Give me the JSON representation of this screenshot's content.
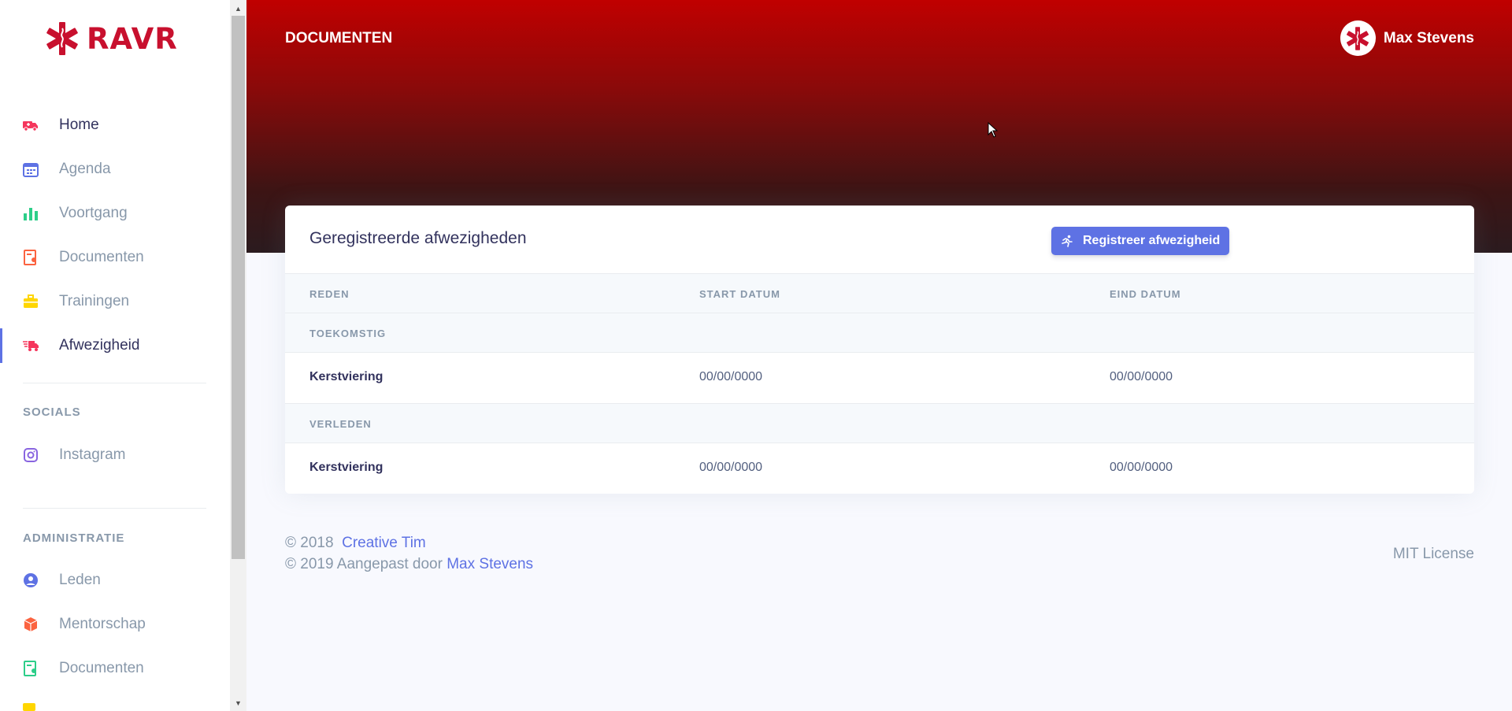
{
  "brand": {
    "name": "RAVR",
    "accent": "#c8102e"
  },
  "sidebar": {
    "items": [
      {
        "label": "Home",
        "icon": "ambulance-icon",
        "color": "#f5365c"
      },
      {
        "label": "Agenda",
        "icon": "calendar-icon",
        "color": "#5e72e4"
      },
      {
        "label": "Voortgang",
        "icon": "bar-chart-icon",
        "color": "#2dce89"
      },
      {
        "label": "Documenten",
        "icon": "document-icon",
        "color": "#fb6340"
      },
      {
        "label": "Trainingen",
        "icon": "briefcase-icon",
        "color": "#ffd600"
      },
      {
        "label": "Afwezigheid",
        "icon": "truck-icon",
        "color": "#f5365c"
      }
    ],
    "socials_heading": "SOCIALS",
    "socials": [
      {
        "label": "Instagram",
        "icon": "instagram-icon",
        "color": "#8965e0"
      }
    ],
    "admin_heading": "ADMINISTRATIE",
    "admin": [
      {
        "label": "Leden",
        "icon": "user-circle-icon",
        "color": "#5e72e4"
      },
      {
        "label": "Mentorschap",
        "icon": "box-icon",
        "color": "#fb6340"
      },
      {
        "label": "Documenten",
        "icon": "document-icon",
        "color": "#2dce89"
      }
    ]
  },
  "header": {
    "page_title": "DOCUMENTEN",
    "user_name": "Max Stevens"
  },
  "card": {
    "title": "Geregistreerde afwezigheden",
    "button_label": "Registreer afwezigheid",
    "columns": [
      "REDEN",
      "START DATUM",
      "EIND DATUM"
    ],
    "groups": [
      {
        "label": "TOEKOMSTIG",
        "rows": [
          {
            "reason": "Kerstviering",
            "start": "00/00/0000",
            "end": "00/00/0000"
          }
        ]
      },
      {
        "label": "VERLEDEN",
        "rows": [
          {
            "reason": "Kerstviering",
            "start": "00/00/0000",
            "end": "00/00/0000"
          }
        ]
      }
    ]
  },
  "footer": {
    "line1_prefix": "© 2018",
    "line1_link": "Creative Tim",
    "line2_prefix": "© 2019 Aangepast door",
    "line2_link": "Max Stevens",
    "license": "MIT License"
  }
}
